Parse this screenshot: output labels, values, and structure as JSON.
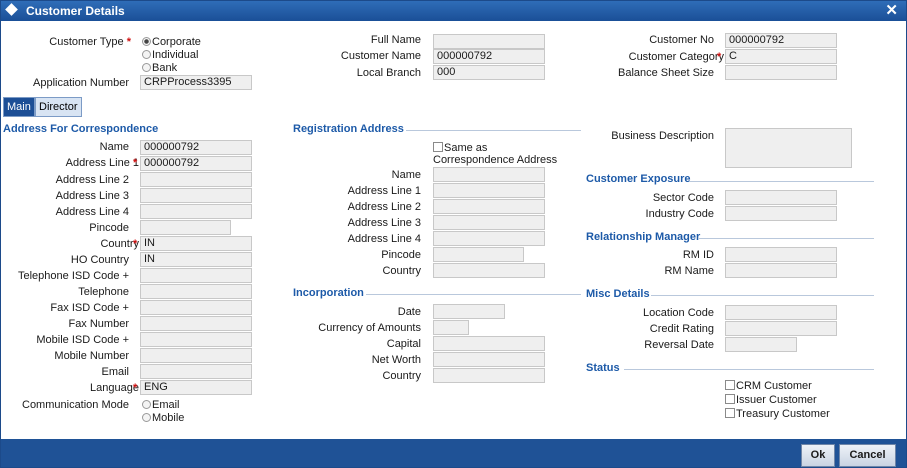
{
  "window": {
    "title": "Customer Details",
    "close_label": "✕"
  },
  "header": {
    "customer_type_label": "Customer Type",
    "customer_type_options": [
      "Corporate",
      "Individual",
      "Bank"
    ],
    "customer_type_selected": "Corporate",
    "application_number_label": "Application Number",
    "application_number_value": "CRPProcess3395",
    "full_name_label": "Full Name",
    "full_name_value": "",
    "customer_name_label": "Customer Name",
    "customer_name_value": "000000792",
    "local_branch_label": "Local Branch",
    "local_branch_value": "000",
    "customer_no_label": "Customer No",
    "customer_no_value": "000000792",
    "customer_category_label": "Customer Category",
    "customer_category_value": "C",
    "balance_sheet_size_label": "Balance Sheet Size",
    "balance_sheet_size_value": ""
  },
  "tabs": [
    {
      "label": "Main"
    },
    {
      "label": "Director"
    }
  ],
  "correspondence": {
    "title": "Address For Correspondence",
    "name_label": "Name",
    "name_value": "000000792",
    "addr1_label": "Address Line 1",
    "addr1_value": "000000792",
    "addr2_label": "Address Line 2",
    "addr3_label": "Address Line 3",
    "addr4_label": "Address Line 4",
    "pincode_label": "Pincode",
    "country_label": "Country",
    "country_value": "IN",
    "ho_country_label": "HO Country",
    "ho_country_value": "IN",
    "tel_isd_label": "Telephone ISD Code +",
    "telephone_label": "Telephone",
    "fax_isd_label": "Fax ISD Code +",
    "fax_number_label": "Fax Number",
    "mobile_isd_label": "Mobile ISD Code +",
    "mobile_number_label": "Mobile Number",
    "email_label": "Email",
    "language_label": "Language",
    "language_value": "ENG",
    "comm_mode_label": "Communication Mode",
    "comm_mode_options": [
      "Email",
      "Mobile"
    ]
  },
  "registration": {
    "title": "Registration Address",
    "same_as_label": "Same as",
    "same_as_label2": "Correspondence Address",
    "name_label": "Name",
    "addr1_label": "Address Line 1",
    "addr2_label": "Address Line 2",
    "addr3_label": "Address Line 3",
    "addr4_label": "Address Line 4",
    "pincode_label": "Pincode",
    "country_label": "Country"
  },
  "incorporation": {
    "title": "Incorporation",
    "date_label": "Date",
    "currency_label": "Currency of Amounts",
    "capital_label": "Capital",
    "net_worth_label": "Net Worth",
    "country_label": "Country"
  },
  "right": {
    "business_description_label": "Business Description",
    "exposure_title": "Customer Exposure",
    "sector_code_label": "Sector Code",
    "industry_code_label": "Industry Code",
    "rm_title": "Relationship Manager",
    "rm_id_label": "RM ID",
    "rm_name_label": "RM Name",
    "misc_title": "Misc Details",
    "location_code_label": "Location Code",
    "credit_rating_label": "Credit Rating",
    "reversal_date_label": "Reversal Date",
    "status_title": "Status",
    "crm_customer_label": "CRM Customer",
    "issuer_customer_label": "Issuer Customer",
    "treasury_customer_label": "Treasury Customer"
  },
  "footer": {
    "ok_label": "Ok",
    "cancel_label": "Cancel"
  },
  "colors": {
    "accent": "#1d5aa8",
    "titlebar": "#1a4f97",
    "required": "#d01010"
  }
}
